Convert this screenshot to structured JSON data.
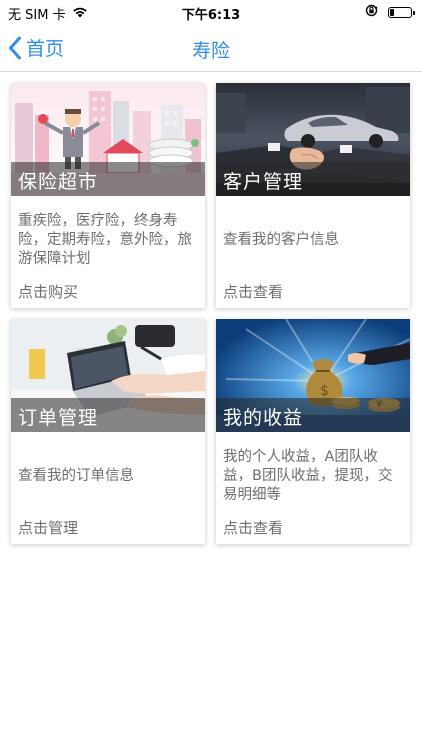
{
  "status_bar": {
    "carrier": "无 SIM 卡",
    "time": "下午6:13",
    "battery_level": 0.2
  },
  "nav": {
    "back_label": "首页",
    "title": "寿险"
  },
  "cards": [
    {
      "title": "保险超市",
      "desc": "重疾险，医疗险，终身寿险，定期寿险，意外险，旅游保障计划",
      "action": "点击购买"
    },
    {
      "title": "客户管理",
      "desc": "查看我的客户信息",
      "action": "点击查看"
    },
    {
      "title": "订单管理",
      "desc": "查看我的订单信息",
      "action": "点击管理"
    },
    {
      "title": "我的收益",
      "desc": "我的个人收益，A团队收益，B团队收益，提现，交易明细等",
      "action": "点击查看"
    }
  ],
  "colors": {
    "accent": "#2f8fe6",
    "text_secondary": "#6e6e6e"
  }
}
